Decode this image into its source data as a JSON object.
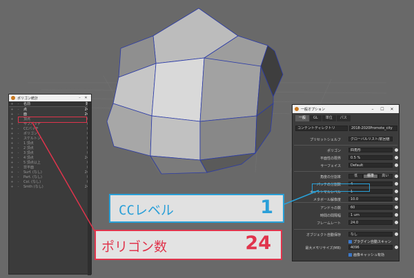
{
  "polygon_window": {
    "title": "ポリゴン統計",
    "header": {
      "name": "名前",
      "value": "数"
    },
    "rows": [
      {
        "name": "点",
        "value": "24"
      },
      {
        "name": "面",
        "value": "24"
      },
      {
        "name": "頂点",
        "value": "0"
      },
      {
        "name": "サブパッチ",
        "value": "0"
      },
      {
        "name": "CCパッチ",
        "value": "0"
      },
      {
        "name": "ポリゴン",
        "value": "0"
      },
      {
        "name": "スケルトン",
        "value": "0"
      },
      {
        "name": "1 頂点",
        "value": "0"
      },
      {
        "name": "2 頂点",
        "value": "0"
      },
      {
        "name": "3 頂点",
        "value": "0"
      },
      {
        "name": "4 頂点",
        "value": "24"
      },
      {
        "name": "5 頂点以上",
        "value": "0"
      },
      {
        "name": "非平面",
        "value": "0"
      },
      {
        "name": "Surf. (なし)",
        "value": "24"
      },
      {
        "name": "Part. (なし)",
        "value": "0"
      },
      {
        "name": "Col. (なし)",
        "value": "0"
      },
      {
        "name": "Smth (なし)",
        "value": "24"
      }
    ]
  },
  "options_window": {
    "title": "一般オプション",
    "tabs": [
      "一般",
      "GL",
      "単位",
      "パス"
    ],
    "content_dir_label": "コンテントディレクトリ",
    "content_dir_value": "2018-2020Promote_city",
    "preset_label": "プリセットシェルフ",
    "preset_value": "グローバルリスト/前回値",
    "rows": [
      {
        "label": "ポリゴン",
        "value": "四角形"
      },
      {
        "label": "平面性の限界",
        "value": "0.5 %"
      },
      {
        "label": "サーフェイス",
        "value": "Default"
      }
    ],
    "subdiv_label": "角度の分割率",
    "subdiv_options": [
      "低",
      "標準",
      "高い"
    ],
    "subdiv_selected": 1,
    "rows2": [
      {
        "label": "パッチの分割数",
        "value": "4"
      },
      {
        "label": "キャットマルレベル",
        "value": "1"
      },
      {
        "label": "メタボール解像度",
        "value": "10.0"
      }
    ],
    "rows3": [
      {
        "label": "アンドゥの数",
        "value": "60"
      },
      {
        "label": "時間の間隔幅",
        "value": "1 um"
      },
      {
        "label": "フレームレート",
        "value": "24.0"
      }
    ],
    "backup_label": "オブジェクト自動保存",
    "backup_value": "なし",
    "plugin_check": "プラグイン自動スキャン",
    "mem_label": "最大メモリサイズ(MB)",
    "mem_value": "4096",
    "cache_check": "画像キャッシュ有効"
  },
  "annotations": {
    "cc_label": "CCレベル",
    "cc_value": "1",
    "polygon_label": "ポリゴン数",
    "polygon_value": "24"
  },
  "colors": {
    "accent_blue": "#28a0d8",
    "accent_red": "#e0344c"
  }
}
